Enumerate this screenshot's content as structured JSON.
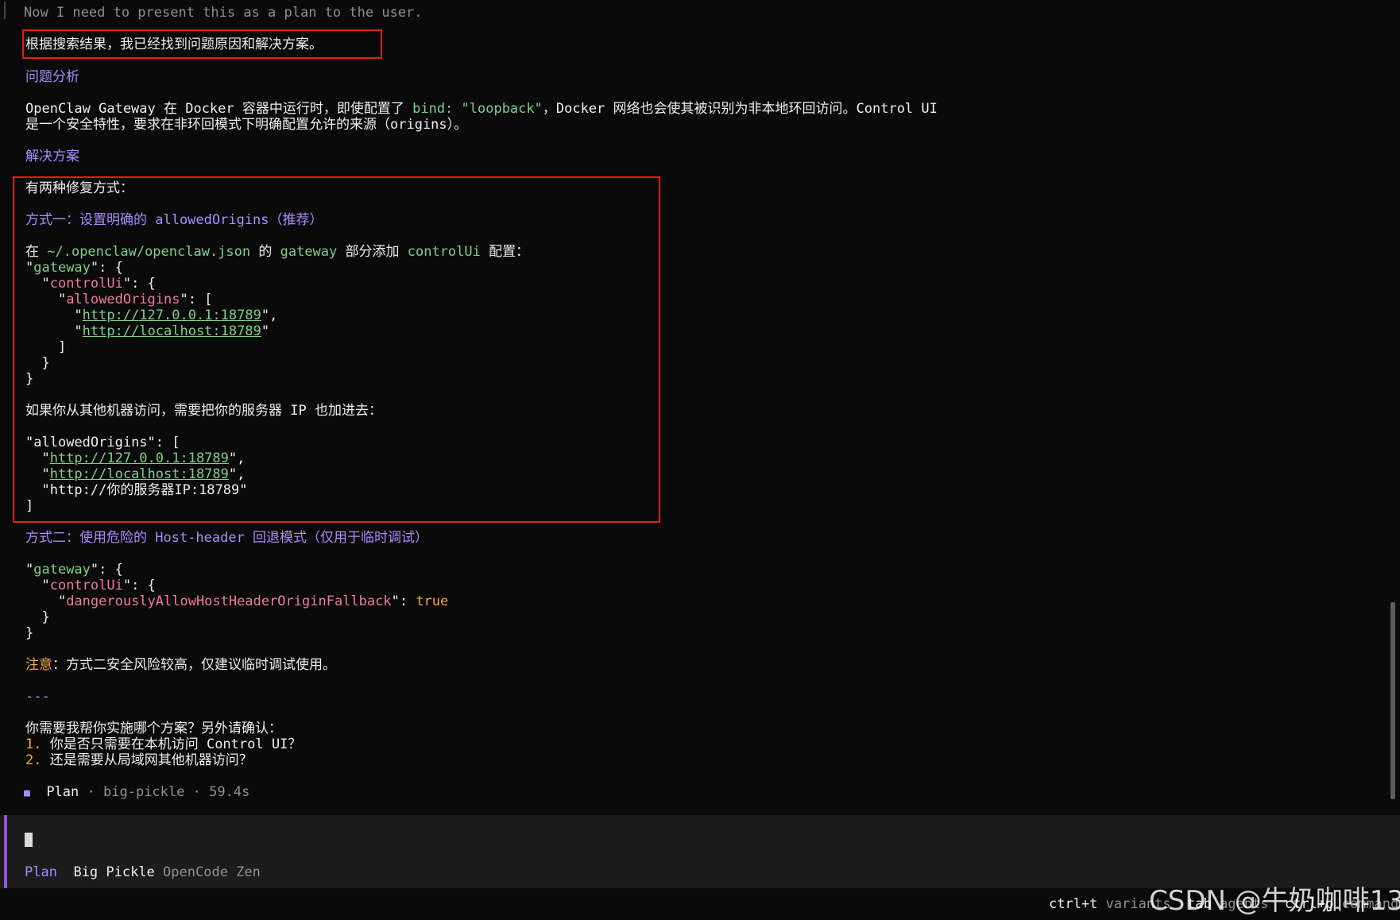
{
  "top_log": "Now I need to present this as a plan to the user.",
  "summary": "根据搜索结果，我已经找到问题原因和解决方案。",
  "analysis": {
    "heading": "问题分析",
    "p1": {
      "a": "OpenClaw Gateway 在 Docker 容器中运行时，即使配置了 ",
      "b": "bind: \"loopback\"",
      "c": "，Docker 网络也会使其被识别为非本地环回访问。Control UI"
    },
    "p2": "是一个安全特性，要求在非环回模式下明确配置允许的来源（origins）。"
  },
  "solution": {
    "heading": "解决方案",
    "intro": "有两种修复方式：",
    "method1": {
      "title": "方式一：设置明确的 allowedOrigins（推荐）",
      "line_a": "在 ",
      "line_b": "~/.openclaw/openclaw.json",
      "line_c": " 的 ",
      "line_d": "gateway",
      "line_e": " 部分添加 ",
      "line_f": "controlUi",
      "line_g": " 配置：",
      "code_gateway": "gateway",
      "code_controlUi": "controlUi",
      "code_allowedOrigins": "allowedOrigins",
      "url1": "http://127.0.0.1:18789",
      "url2": "http://localhost:18789",
      "remote_note": "如果你从其他机器访问，需要把你的服务器 IP 也加进去：",
      "url3": "http://你的服务器IP:18789"
    },
    "method2": {
      "title": "方式二：使用危险的 Host-header 回退模式（仅用于临时调试）",
      "fallback_key": "dangerouslyAllowHostHeaderOriginFallback",
      "fallback_val": "true"
    },
    "note_label": "注意",
    "note_text": "：方式二安全风险较高，仅建议临时调试使用。",
    "separator": "---",
    "question": "你需要我帮你实施哪个方案？另外请确认：",
    "q1_num": "1.",
    "q1": " 你是否只需要在本机访问 Control UI？",
    "q2_num": "2.",
    "q2": " 还是需要从局域网其他机器访问？"
  },
  "status": {
    "icon": "square-icon",
    "mode": "Plan",
    "model": "big-pickle",
    "time": "59.4s",
    "sep": "·"
  },
  "input": {
    "mode": "Plan",
    "model": "Big Pickle",
    "provider": "OpenCode Zen"
  },
  "shortcuts": {
    "k1": "ctrl+t",
    "l1": "variants",
    "k2": "tab",
    "l2": "agents",
    "k3": "ctrl+p",
    "l3": "commands"
  },
  "watermark": "CSDN @牛奶咖啡13",
  "colors": {
    "background": "#0a0a0a",
    "accent_purple": "#a98cff",
    "string_green": "#7fd088",
    "key_pink": "#f07c9a",
    "warning_orange": "#f5a742",
    "highlight_box": "#e11c1c"
  }
}
